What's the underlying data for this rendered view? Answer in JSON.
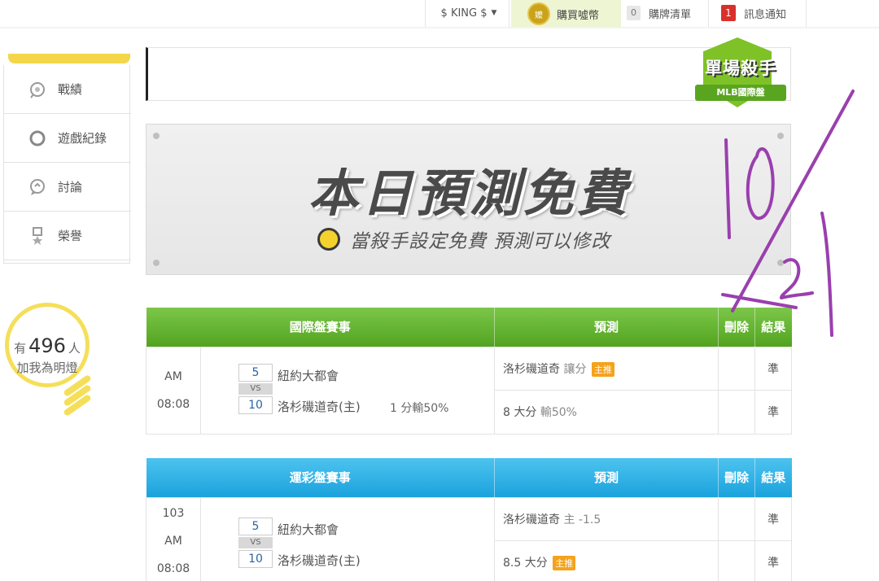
{
  "topbar": {
    "user_name": "$ KING $",
    "coin_icon_text": "嬤",
    "buy_coins": "購買噓幣",
    "cart_count": "0",
    "cart_label": "購牌清單",
    "notify_count": "1",
    "notify_label": "訊息通知"
  },
  "sidebar": {
    "items": [
      {
        "label": "戰績",
        "icon": "trophy-icon"
      },
      {
        "label": "遊戲紀錄",
        "icon": "circle-icon"
      },
      {
        "label": "討論",
        "icon": "chat-icon"
      },
      {
        "label": "榮譽",
        "icon": "medal-icon"
      }
    ],
    "fans_prefix": "有",
    "fans_count": "496",
    "fans_suffix": "人",
    "fans_line2": "加我為明燈"
  },
  "badge": {
    "title": "單場殺手",
    "ribbon": "MLB國際盤"
  },
  "banner": {
    "title": "本日預測免費",
    "subtitle": "當殺手設定免費 預測可以修改"
  },
  "international": {
    "headers": [
      "國際盤賽事",
      "預測",
      "刪除",
      "結果"
    ],
    "time": "AM 08:08",
    "away_score": "5",
    "home_score": "10",
    "vs": "VS",
    "away_team": "紐約大都會",
    "home_team": "洛杉磯道奇(主)",
    "handicap": "1 分輸50%",
    "pred1_main": "洛杉磯道奇",
    "pred1_sub": "讓分",
    "pred1_tag": "主推",
    "pred2_main": "8 大分",
    "pred2_sub": "輸50%",
    "result1": "準",
    "result2": "準"
  },
  "sports_lottery": {
    "headers": [
      "運彩盤賽事",
      "預測",
      "刪除",
      "結果"
    ],
    "game_no": "103",
    "time": "AM 08:08",
    "away_score": "5",
    "home_score": "10",
    "vs": "VS",
    "away_team": "紐約大都會",
    "home_team": "洛杉磯道奇(主)",
    "pred1_main": "洛杉磯道奇",
    "pred1_sub": "主 -1.5",
    "pred2_main": "8.5 大分",
    "pred2_tag": "主推",
    "result1": "準",
    "result2": "準"
  },
  "colors": {
    "green_header": "#5eb22c",
    "blue_header": "#27abe2",
    "accent_yellow": "#f5df5a",
    "scribble": "#9a3fae"
  }
}
